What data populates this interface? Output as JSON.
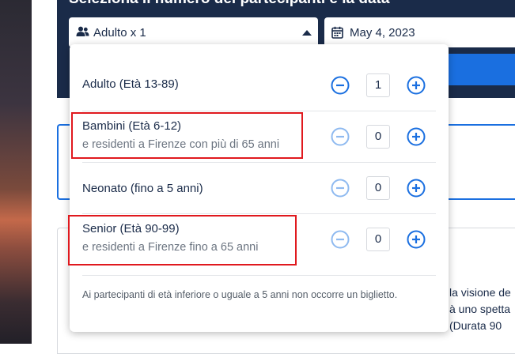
{
  "panel": {
    "title": "Seleziona il numero dei partecipanti e la data",
    "participants_summary": "Adulto x 1",
    "participants_icon": "people-icon",
    "date_value": "May 4, 2023",
    "date_icon": "calendar-icon"
  },
  "dropdown": {
    "rows": [
      {
        "title": "Adulto (Età 13-89)",
        "subtitle": "",
        "quantity": "1",
        "minus_enabled": true
      },
      {
        "title": "Bambini (Età 6-12)",
        "subtitle": "e residenti a Firenze con più di 65 anni",
        "quantity": "0",
        "minus_enabled": false
      },
      {
        "title": "Neonato (fino a 5 anni)",
        "subtitle": "",
        "quantity": "0",
        "minus_enabled": false
      },
      {
        "title": "Senior (Età 90-99)",
        "subtitle": "e residenti a Firenze fino a 65 anni",
        "quantity": "0",
        "minus_enabled": false
      }
    ],
    "note": "Ai partecipanti di età inferiore o uguale a 5 anni non occorre un biglietto."
  },
  "background": {
    "desc_lines": [
      "la visione de",
      "à uno spetta",
      "(Durata 90"
    ]
  },
  "colors": {
    "navy": "#1a2b49",
    "accent_blue": "#1a6fe0",
    "disabled_blue": "#8fbaf0",
    "highlight_red": "#e0191e"
  }
}
